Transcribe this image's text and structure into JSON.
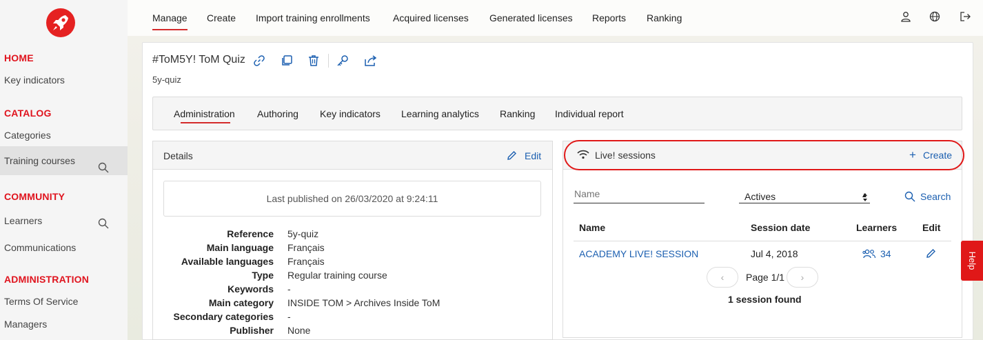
{
  "sidebar": {
    "sections": [
      {
        "title": "HOME",
        "items": [
          "Key indicators"
        ]
      },
      {
        "title": "CATALOG",
        "items": [
          "Categories",
          "Training courses"
        ]
      },
      {
        "title": "COMMUNITY",
        "items": [
          "Learners",
          "Communications"
        ]
      },
      {
        "title": "ADMINISTRATION",
        "items": [
          "Terms Of Service",
          "Managers"
        ]
      }
    ]
  },
  "topnav": {
    "items": [
      "Manage",
      "Create",
      "Import training enrollments",
      "Acquired licenses",
      "Generated licenses",
      "Reports",
      "Ranking"
    ],
    "active": "Manage"
  },
  "course": {
    "title": "#ToM5Y! ToM Quiz",
    "subtitle": "5y-quiz"
  },
  "tabs": {
    "items": [
      "Administration",
      "Authoring",
      "Key indicators",
      "Learning analytics",
      "Ranking",
      "Individual report"
    ],
    "active": "Administration"
  },
  "details": {
    "title": "Details",
    "edit_label": "Edit",
    "published": "Last published on 26/03/2020 at 9:24:11",
    "rows": [
      {
        "key": "Reference",
        "value": "5y-quiz"
      },
      {
        "key": "Main language",
        "value": "Français"
      },
      {
        "key": "Available languages",
        "value": "Français"
      },
      {
        "key": "Type",
        "value": "Regular training course"
      },
      {
        "key": "Keywords",
        "value": "-"
      },
      {
        "key": "Main category",
        "value": "INSIDE TOM > Archives Inside ToM"
      },
      {
        "key": "Secondary categories",
        "value": "-"
      },
      {
        "key": "Publisher",
        "value": "None"
      }
    ]
  },
  "live": {
    "title": "Live! sessions",
    "create_label": "Create",
    "name_placeholder": "Name",
    "filter_value": "Actives",
    "search_label": "Search",
    "headers": {
      "name": "Name",
      "date": "Session date",
      "learners": "Learners",
      "edit": "Edit"
    },
    "rows": [
      {
        "name": "ACADEMY LIVE! SESSION",
        "date": "Jul 4, 2018",
        "learners": "34"
      }
    ],
    "page_label": "Page 1/1",
    "found_label": "1 session found"
  },
  "help_label": "Help",
  "colors": {
    "brand_red": "#e0141e",
    "link_blue": "#1b5fb0"
  }
}
